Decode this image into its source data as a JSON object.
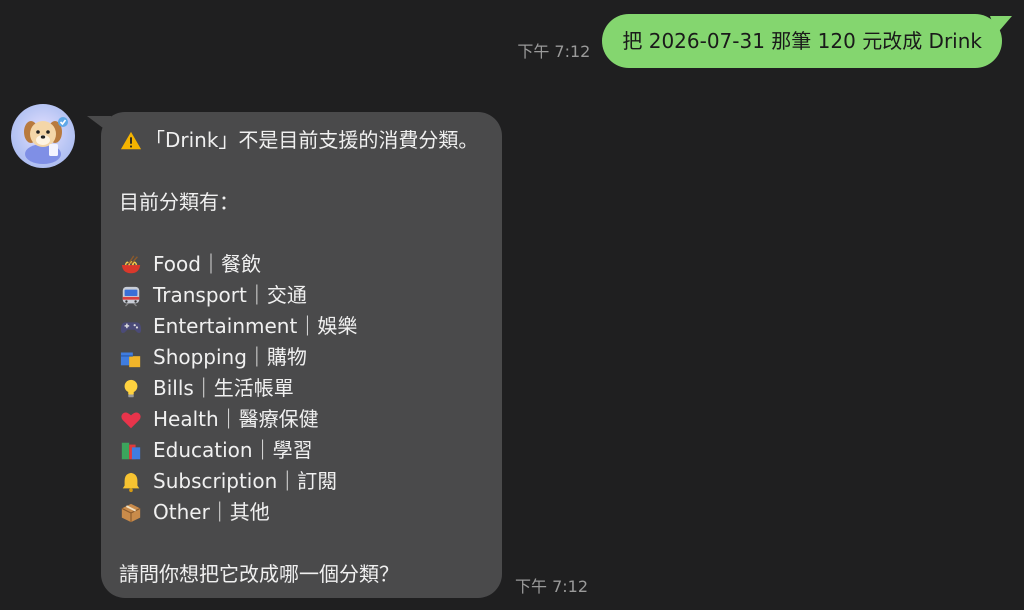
{
  "outgoing": {
    "time": "下午 7:12",
    "text": "把 2026-07-31 那筆 120 元改成 Drink"
  },
  "incoming": {
    "time": "下午 7:12",
    "warning": "「Drink」不是目前支援的消費分類。",
    "intro": "目前分類有：",
    "categories": [
      {
        "icon": "noodle-bowl-icon",
        "label": "Food｜餐飲"
      },
      {
        "icon": "train-icon",
        "label": "Transport｜交通"
      },
      {
        "icon": "game-controller-icon",
        "label": "Entertainment｜娛樂"
      },
      {
        "icon": "shopping-bags-icon",
        "label": "Shopping｜購物"
      },
      {
        "icon": "light-bulb-icon",
        "label": "Bills｜生活帳單"
      },
      {
        "icon": "heart-icon",
        "label": "Health｜醫療保健"
      },
      {
        "icon": "books-icon",
        "label": "Education｜學習"
      },
      {
        "icon": "bell-icon",
        "label": "Subscription｜訂閱"
      },
      {
        "icon": "package-icon",
        "label": "Other｜其他"
      }
    ],
    "question": "請問你想把它改成哪一個分類？"
  },
  "colors": {
    "background": "#1f1f20",
    "outgoing_bubble": "#84d66f",
    "incoming_bubble": "#4a4a4b",
    "time_text": "#9a9a9a"
  }
}
